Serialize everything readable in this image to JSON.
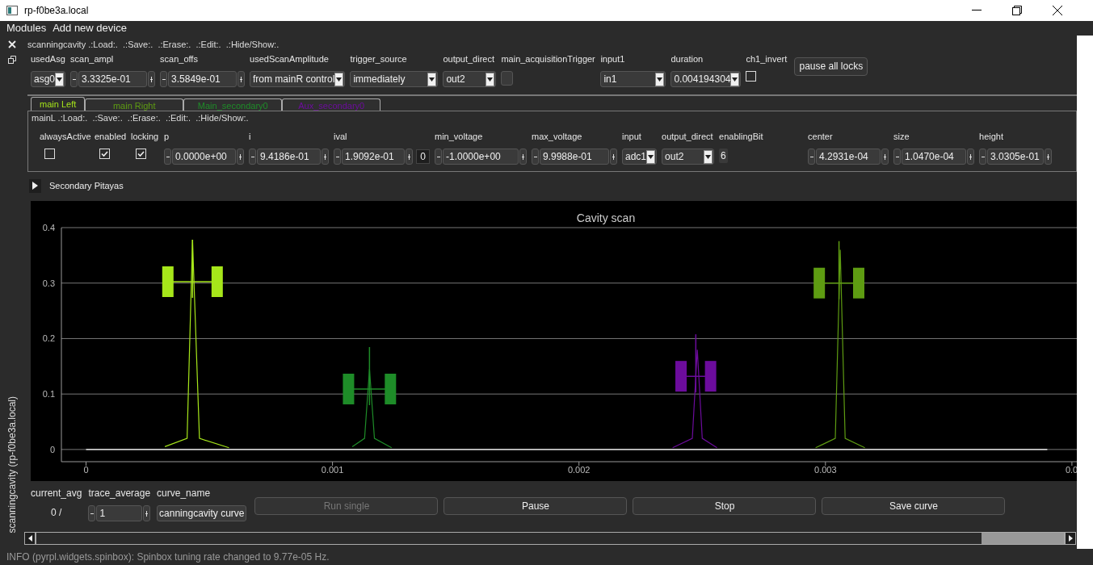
{
  "window": {
    "title": "rp-f0be3a.local"
  },
  "menu": [
    "Modules",
    "Add new device"
  ],
  "dock": {
    "title": "scanningcavity (rp-f0be3a.local)"
  },
  "module": {
    "header": "scanningcavity .:Load:.  .:Save:.  .:Erase:.  .:Edit:.  .:Hide/Show:.",
    "controls": [
      {
        "label": "usedAsg",
        "kind": "combo",
        "value": "asg0"
      },
      {
        "label": "scan_ampl",
        "kind": "spin",
        "value": "3.3325e-01"
      },
      {
        "label": "scan_offs",
        "kind": "spin",
        "value": "3.5849e-01"
      },
      {
        "label": "usedScanAmplitude",
        "kind": "combo",
        "value": "from mainR control"
      },
      {
        "label": "trigger_source",
        "kind": "combo",
        "value": "immediately"
      },
      {
        "label": "output_direct",
        "kind": "combo",
        "value": "out2"
      },
      {
        "label": "main_acquisitionTrigger",
        "kind": "toggle",
        "checked": false
      },
      {
        "label": "input1",
        "kind": "combo",
        "value": "in1"
      },
      {
        "label": "duration",
        "kind": "combo",
        "value": "0.004194304"
      },
      {
        "label": "ch1_invert",
        "kind": "checkbox",
        "checked": false
      },
      {
        "label": "pause all locks",
        "kind": "button"
      }
    ]
  },
  "tabs": [
    {
      "label": "main Left",
      "selected": true,
      "color": "#a6e61a"
    },
    {
      "label": "main Right",
      "selected": false,
      "color": "#5e9c12"
    },
    {
      "label": "Main_secondary0",
      "selected": false,
      "color": "#1e8c28"
    },
    {
      "label": "Aux_secondary0",
      "selected": false,
      "color": "#6c0c9c"
    }
  ],
  "lock": {
    "header": "mainL .:Load:.  .:Save:.  .:Erase:.  .:Edit:.  .:Hide/Show:.",
    "controls": [
      {
        "label": "alwaysActive",
        "kind": "checkbox",
        "checked": false
      },
      {
        "label": "enabled",
        "kind": "checkbox",
        "checked": true
      },
      {
        "label": "locking",
        "kind": "checkbox",
        "checked": true
      },
      {
        "label": "p",
        "kind": "spin",
        "value": "0.0000e+00"
      },
      {
        "label": "i",
        "kind": "spin",
        "value": "9.4186e-01"
      },
      {
        "label": "ival",
        "kind": "spin",
        "value": "1.9092e-01",
        "extra": "0"
      },
      {
        "label": "min_voltage",
        "kind": "spin",
        "value": "-1.0000e+00"
      },
      {
        "label": "max_voltage",
        "kind": "spin",
        "value": "9.9988e-01"
      },
      {
        "label": "input",
        "kind": "combo",
        "value": "adc1"
      },
      {
        "label": "output_direct",
        "kind": "combo",
        "value": "out2"
      },
      {
        "label": "enablingBit",
        "kind": "field",
        "value": "6"
      },
      {
        "label": "center",
        "kind": "spin",
        "value": "4.2931e-04"
      },
      {
        "label": "size",
        "kind": "spin",
        "value": "1.0470e-04"
      },
      {
        "label": "height",
        "kind": "spin",
        "value": "3.0305e-01"
      }
    ]
  },
  "secondary": {
    "label": "Secondary Pitayas",
    "expanded": false
  },
  "plot": {
    "chart_data": {
      "type": "line",
      "title": "Cavity scan",
      "x": [
        0,
        0.00032,
        0.00041,
        0.000432,
        0.00046,
        0.00058,
        0.00108,
        0.00113,
        0.00115,
        0.00117,
        0.00124,
        0.00238,
        0.00246,
        0.00248,
        0.0025,
        0.00256,
        0.00296,
        0.00304,
        0.00306,
        0.00308,
        0.00316,
        0.0039
      ],
      "grid": true,
      "series": [
        {
          "color": "#ffffff",
          "values": [
            0,
            0,
            0,
            0,
            0,
            0,
            0,
            0,
            0,
            0,
            0,
            0,
            0,
            0,
            0,
            0,
            0,
            0,
            0,
            0,
            0,
            0
          ]
        },
        {
          "color": "#a6e61a",
          "values": [
            null,
            0.005,
            0.02,
            0.378,
            0.02,
            0.003,
            null,
            null,
            null,
            null,
            null,
            null,
            null,
            null,
            null,
            null,
            null,
            null,
            null,
            null,
            null,
            null
          ]
        },
        {
          "color": "#1e8c28",
          "values": [
            null,
            null,
            null,
            null,
            null,
            null,
            0.005,
            0.02,
            0.145,
            0.02,
            0.003,
            null,
            null,
            null,
            null,
            null,
            null,
            null,
            null,
            null,
            null,
            null
          ]
        },
        {
          "color": "#6c0c9c",
          "values": [
            null,
            null,
            null,
            null,
            null,
            null,
            null,
            null,
            null,
            null,
            null,
            0.003,
            0.02,
            0.18,
            0.02,
            0.003,
            null,
            null,
            null,
            null,
            null,
            null
          ]
        },
        {
          "color": "#5e9c12",
          "values": [
            null,
            null,
            null,
            null,
            null,
            null,
            null,
            null,
            null,
            null,
            null,
            null,
            null,
            null,
            null,
            null,
            0.003,
            0.02,
            0.36,
            0.02,
            0.003,
            null
          ]
        }
      ],
      "xlim": [
        -0.0001,
        0.00402
      ],
      "ylim": [
        -0.022,
        0.4
      ],
      "xticks": [
        0,
        0.001,
        0.002,
        0.003,
        {
          "value": 0.004,
          "label": "0.0"
        }
      ],
      "yticks": [
        0,
        0.1,
        0.2,
        0.3,
        0.4
      ]
    },
    "markers": [
      {
        "color": "#a6e61a"
      },
      {
        "color": "#1e8c28"
      },
      {
        "color": "#6c0c9c"
      },
      {
        "color": "#5e9c12"
      }
    ]
  },
  "acquisition": {
    "current_avg": {
      "label": "current_avg",
      "value": "0 /"
    },
    "trace_average": {
      "label": "trace_average",
      "value": "1"
    },
    "curve_name": {
      "label": "curve_name",
      "value": "canningcavity curve"
    },
    "buttons": [
      {
        "label": "Run single",
        "disabled": true
      },
      {
        "label": "Pause",
        "disabled": false
      },
      {
        "label": "Stop",
        "disabled": false
      },
      {
        "label": "Save curve",
        "disabled": false
      }
    ]
  },
  "status_bar": "INFO (pyrpl.widgets.spinbox): Spinbox tuning rate changed to 9.77e-05 Hz."
}
